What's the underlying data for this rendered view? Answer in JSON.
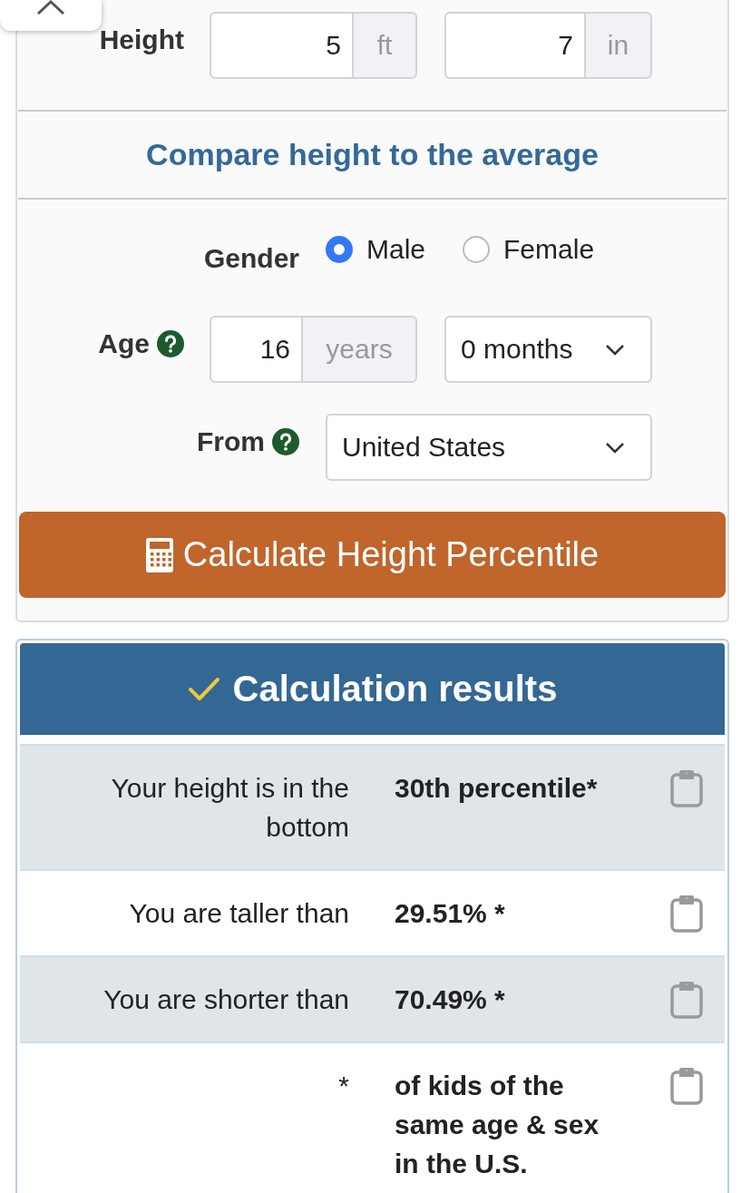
{
  "height": {
    "label": "Height",
    "feet": {
      "value": "5",
      "unit": "ft"
    },
    "inches": {
      "value": "7",
      "unit": "in"
    }
  },
  "compare_link": {
    "label": "Compare height to the average"
  },
  "gender": {
    "label": "Gender",
    "options": [
      {
        "label": "Male",
        "selected": true
      },
      {
        "label": "Female",
        "selected": false
      }
    ]
  },
  "age": {
    "label": "Age",
    "help": true,
    "years": {
      "value": "16",
      "unit": "years"
    },
    "months": {
      "value": "0 months"
    }
  },
  "from": {
    "label": "From",
    "help": true,
    "country": {
      "value": "United States"
    }
  },
  "calculate_button": {
    "label": "Calculate Height Percentile"
  },
  "results": {
    "title": "Calculation results",
    "rows": [
      {
        "label": "Your height is in the bottom",
        "value": "30th percentile*"
      },
      {
        "label": "You are taller than",
        "value": "29.51% *"
      },
      {
        "label": "You are shorter than",
        "value": "70.49% *"
      },
      {
        "label": "*",
        "value": "of kids of the same age & sex in the U.S."
      }
    ]
  }
}
